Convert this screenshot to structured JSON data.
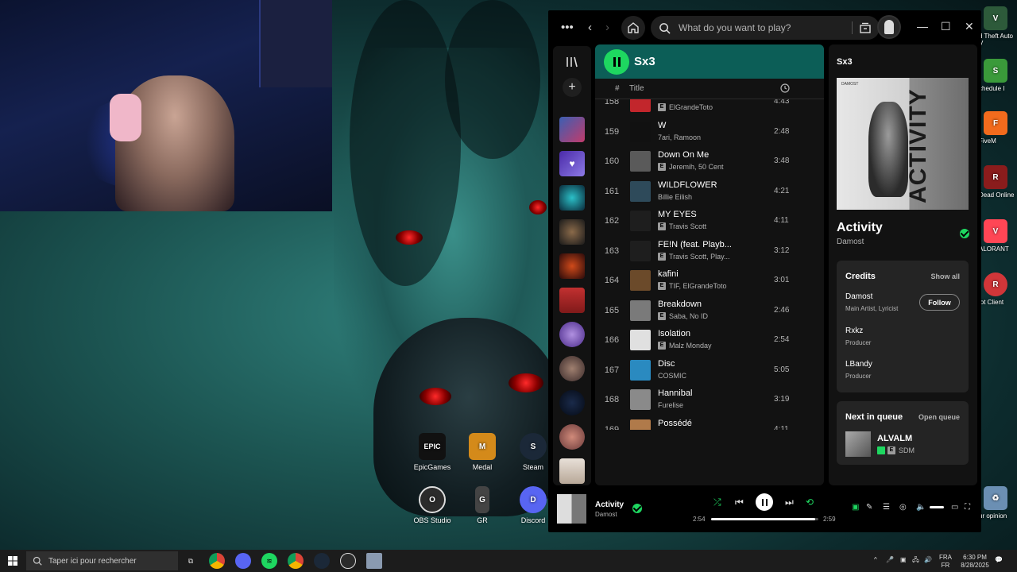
{
  "desktop": {
    "icons": [
      {
        "label": "EpicGames",
        "glyph": "EPIC",
        "color": "#111111"
      },
      {
        "label": "Medal",
        "glyph": "M",
        "color": "#d48a1a"
      },
      {
        "label": "Steam",
        "glyph": "S",
        "color": "#1b2838"
      },
      {
        "label": "OBS Studio",
        "glyph": "O",
        "color": "#2b2b2b"
      },
      {
        "label": "GR",
        "glyph": "G",
        "color": "#444444"
      },
      {
        "label": "Discord",
        "glyph": "D",
        "color": "#5865f2"
      }
    ],
    "right_icons": [
      {
        "label": "d Theft Auto V",
        "glyph": "V",
        "color": "#2d5a3a"
      },
      {
        "label": "chedule I",
        "glyph": "S",
        "color": "#3a9a3a"
      },
      {
        "label": "FiveM",
        "glyph": "F",
        "color": "#f26b1d"
      },
      {
        "label": "Dead Online",
        "glyph": "R",
        "color": "#8a1c1c"
      },
      {
        "label": "ALORANT",
        "glyph": "V",
        "color": "#ff4655"
      },
      {
        "label": "iot Client",
        "glyph": "R",
        "color": "#d13639"
      },
      {
        "label": "ur opinion",
        "glyph": "♻",
        "color": "#6b8fb3"
      }
    ]
  },
  "spotify": {
    "search_placeholder": "What do you want to play?",
    "playlist_title": "Sx3",
    "col_number": "#",
    "col_title": "Title",
    "tracks": [
      {
        "num": "158",
        "title": "",
        "artist": "ElGrandeToto",
        "explicit": true,
        "duration": "4:43",
        "color": "#c2262c"
      },
      {
        "num": "159",
        "title": "W",
        "artist": "7ari, Ramoon",
        "explicit": false,
        "duration": "2:48",
        "color": "#111111"
      },
      {
        "num": "160",
        "title": "Down On Me",
        "artist": "Jeremih, 50 Cent",
        "explicit": true,
        "duration": "3:48",
        "color": "#5a5a5a"
      },
      {
        "num": "161",
        "title": "WILDFLOWER",
        "artist": "Billie Eilish",
        "explicit": false,
        "duration": "4:21",
        "color": "#2e4a5a"
      },
      {
        "num": "162",
        "title": "MY EYES",
        "artist": "Travis Scott",
        "explicit": true,
        "duration": "4:11",
        "color": "#1e1e1e"
      },
      {
        "num": "163",
        "title": "FE!N (feat. Playb...",
        "artist": "Travis Scott, Play...",
        "explicit": true,
        "duration": "3:12",
        "color": "#1e1e1e"
      },
      {
        "num": "164",
        "title": "kafini",
        "artist": "TIF, ElGrandeToto",
        "explicit": true,
        "duration": "3:01",
        "color": "#6b4a2a"
      },
      {
        "num": "165",
        "title": "Breakdown",
        "artist": "Saba, No ID",
        "explicit": true,
        "duration": "2:46",
        "color": "#7a7a7a"
      },
      {
        "num": "166",
        "title": "Isolation",
        "artist": "Malz Monday",
        "explicit": true,
        "duration": "2:54",
        "color": "#e0e0e0"
      },
      {
        "num": "167",
        "title": "Disc",
        "artist": "COSMIC",
        "explicit": false,
        "duration": "5:05",
        "color": "#2a8ac0"
      },
      {
        "num": "168",
        "title": "Hannibal",
        "artist": "Furelise",
        "explicit": false,
        "duration": "3:19",
        "color": "#8a8a8a"
      },
      {
        "num": "169",
        "title": "Possédé",
        "artist": "",
        "explicit": false,
        "duration": "4:11",
        "color": "#b07a4a"
      }
    ],
    "now_playing": {
      "panel_title": "Sx3",
      "cover_label": "DAMOST",
      "cover_word": "ACTIVITY",
      "song": "Activity",
      "artist": "Damost"
    },
    "credits": {
      "heading": "Credits",
      "show_all": "Show all",
      "people": [
        {
          "name": "Damost",
          "role": "Main Artist, Lyricist"
        },
        {
          "name": "Rxkz",
          "role": "Producer"
        },
        {
          "name": "LBandy",
          "role": "Producer"
        }
      ],
      "follow_label": "Follow"
    },
    "queue": {
      "heading": "Next in queue",
      "open": "Open queue",
      "title": "ALVALM",
      "artist": "SDM"
    },
    "player": {
      "title": "Activity",
      "artist": "Damost",
      "elapsed": "2:54",
      "total": "2:59",
      "progress_fraction": 0.97
    },
    "accent": "#1ed760"
  },
  "taskbar": {
    "search_placeholder": "Taper ici pour rechercher",
    "lang_top": "FRA",
    "lang_bottom": "FR",
    "time": "6:30 PM",
    "date": "8/28/2025"
  }
}
